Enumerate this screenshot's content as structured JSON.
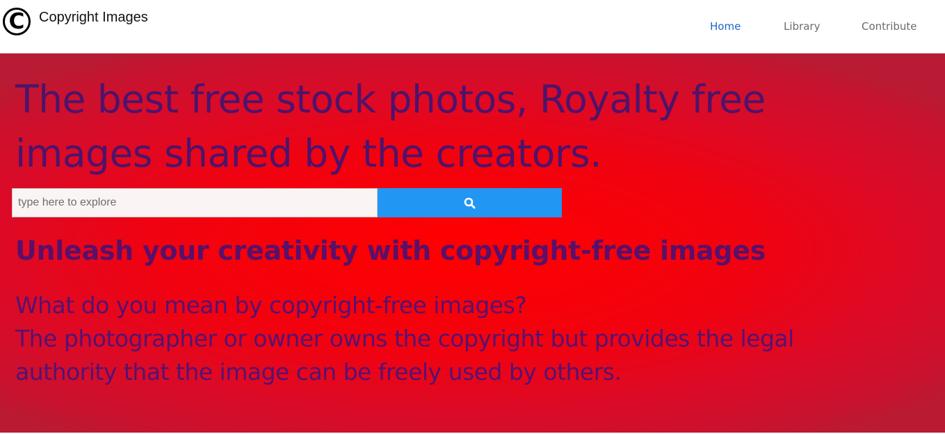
{
  "navbar": {
    "logo_glyph": "C",
    "brand": "Copyright Images",
    "links": [
      {
        "label": "Home",
        "active": true
      },
      {
        "label": "Library",
        "active": false
      },
      {
        "label": "Contribute",
        "active": false
      }
    ],
    "active_color": "#1a66c2",
    "link_color": "#6b6b6b"
  },
  "hero": {
    "title": "The best free stock photos, Royalty free images shared by the creators.",
    "search": {
      "placeholder": "type here to explore",
      "value": "",
      "button_icon": "search-icon",
      "button_color": "#2196f3"
    },
    "subtitle": "Unleash your creativity with copyright-free images",
    "question": "What do you mean by copyright-free images?",
    "answer_line1": "The photographer or owner owns the copyright but provides the legal",
    "answer_line2": "authority that the image can be freely used by others.",
    "background_color": "#ff0000",
    "text_color": "#4e136b"
  }
}
